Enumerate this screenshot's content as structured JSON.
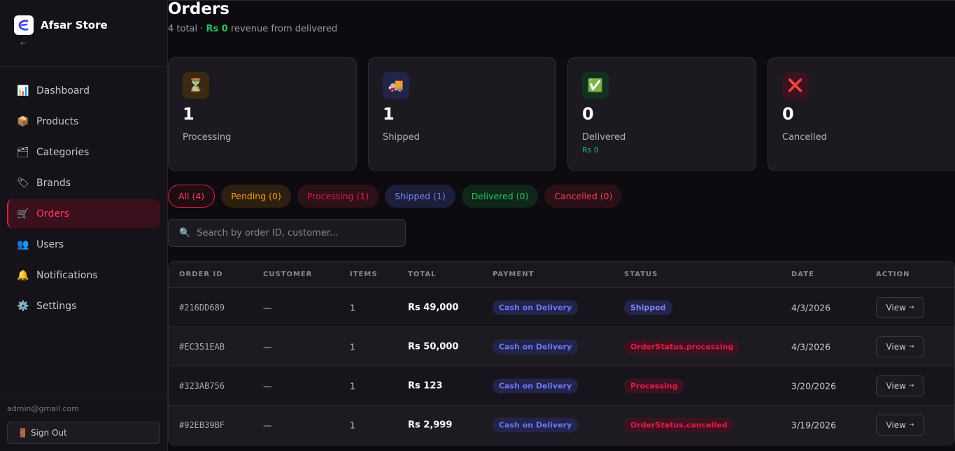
{
  "app": {
    "store_name": "Afsar Store",
    "collapse_label": "←"
  },
  "sidebar": {
    "items": [
      {
        "label": "Dashboard",
        "icon": "📊"
      },
      {
        "label": "Products",
        "icon": "📦"
      },
      {
        "label": "Categories",
        "icon": "🗂"
      },
      {
        "label": "Brands",
        "icon": "🏷"
      },
      {
        "label": "Orders",
        "icon": "🛒"
      },
      {
        "label": "Users",
        "icon": "👥"
      },
      {
        "label": "Notifications",
        "icon": "🔔"
      },
      {
        "label": "Settings",
        "icon": "⚙️"
      }
    ],
    "active_index": 4,
    "admin_email": "admin@gmail.com",
    "sign_out_label": "Sign Out",
    "sign_out_icon": "🚪"
  },
  "header": {
    "title": "Orders",
    "subtitle_prefix": "4 total · ",
    "subtitle_revenue": "Rs 0",
    "subtitle_suffix": " revenue from delivered"
  },
  "stats": [
    {
      "icon": "⏳",
      "value": "1",
      "label": "Processing",
      "sub": "",
      "icon_bg": "#3a2a12"
    },
    {
      "icon": "🚚",
      "value": "1",
      "label": "Shipped",
      "sub": "",
      "icon_bg": "#23244a"
    },
    {
      "icon": "✅",
      "value": "0",
      "label": "Delivered",
      "sub": "Rs 0",
      "icon_bg": "#123221"
    },
    {
      "icon": "❌",
      "value": "0",
      "label": "Cancelled",
      "sub": "",
      "icon_bg": "#3a1220"
    }
  ],
  "filters": [
    {
      "label": "All (4)",
      "kind": "all"
    },
    {
      "label": "Pending (0)",
      "kind": "pending"
    },
    {
      "label": "Processing (1)",
      "kind": "processing"
    },
    {
      "label": "Shipped (1)",
      "kind": "shipped"
    },
    {
      "label": "Delivered (0)",
      "kind": "delivered"
    },
    {
      "label": "Cancelled (0)",
      "kind": "cancelled"
    }
  ],
  "search": {
    "placeholder": "Search by order ID, customer...",
    "icon": "🔍"
  },
  "table": {
    "columns": [
      "ORDER ID",
      "CUSTOMER",
      "ITEMS",
      "TOTAL",
      "PAYMENT",
      "STATUS",
      "DATE",
      "ACTION"
    ],
    "rows": [
      {
        "id": "#216DD689",
        "customer": "—",
        "items": "1",
        "total": "Rs 49,000",
        "payment": "Cash on Delivery",
        "status": "Shipped",
        "status_kind": "shipped",
        "date": "4/3/2026",
        "action": "View"
      },
      {
        "id": "#EC351EAB",
        "customer": "—",
        "items": "1",
        "total": "Rs 50,000",
        "payment": "Cash on Delivery",
        "status": "OrderStatus.processing",
        "status_kind": "processing",
        "date": "4/3/2026",
        "action": "View"
      },
      {
        "id": "#323AB756",
        "customer": "—",
        "items": "1",
        "total": "Rs 123",
        "payment": "Cash on Delivery",
        "status": "Processing",
        "status_kind": "processing",
        "date": "3/20/2026",
        "action": "View"
      },
      {
        "id": "#92EB39BF",
        "customer": "—",
        "items": "1",
        "total": "Rs 2,999",
        "payment": "Cash on Delivery",
        "status": "OrderStatus.cancelled",
        "status_kind": "processing",
        "date": "3/19/2026",
        "action": "View"
      }
    ],
    "action_arrow": "→"
  }
}
